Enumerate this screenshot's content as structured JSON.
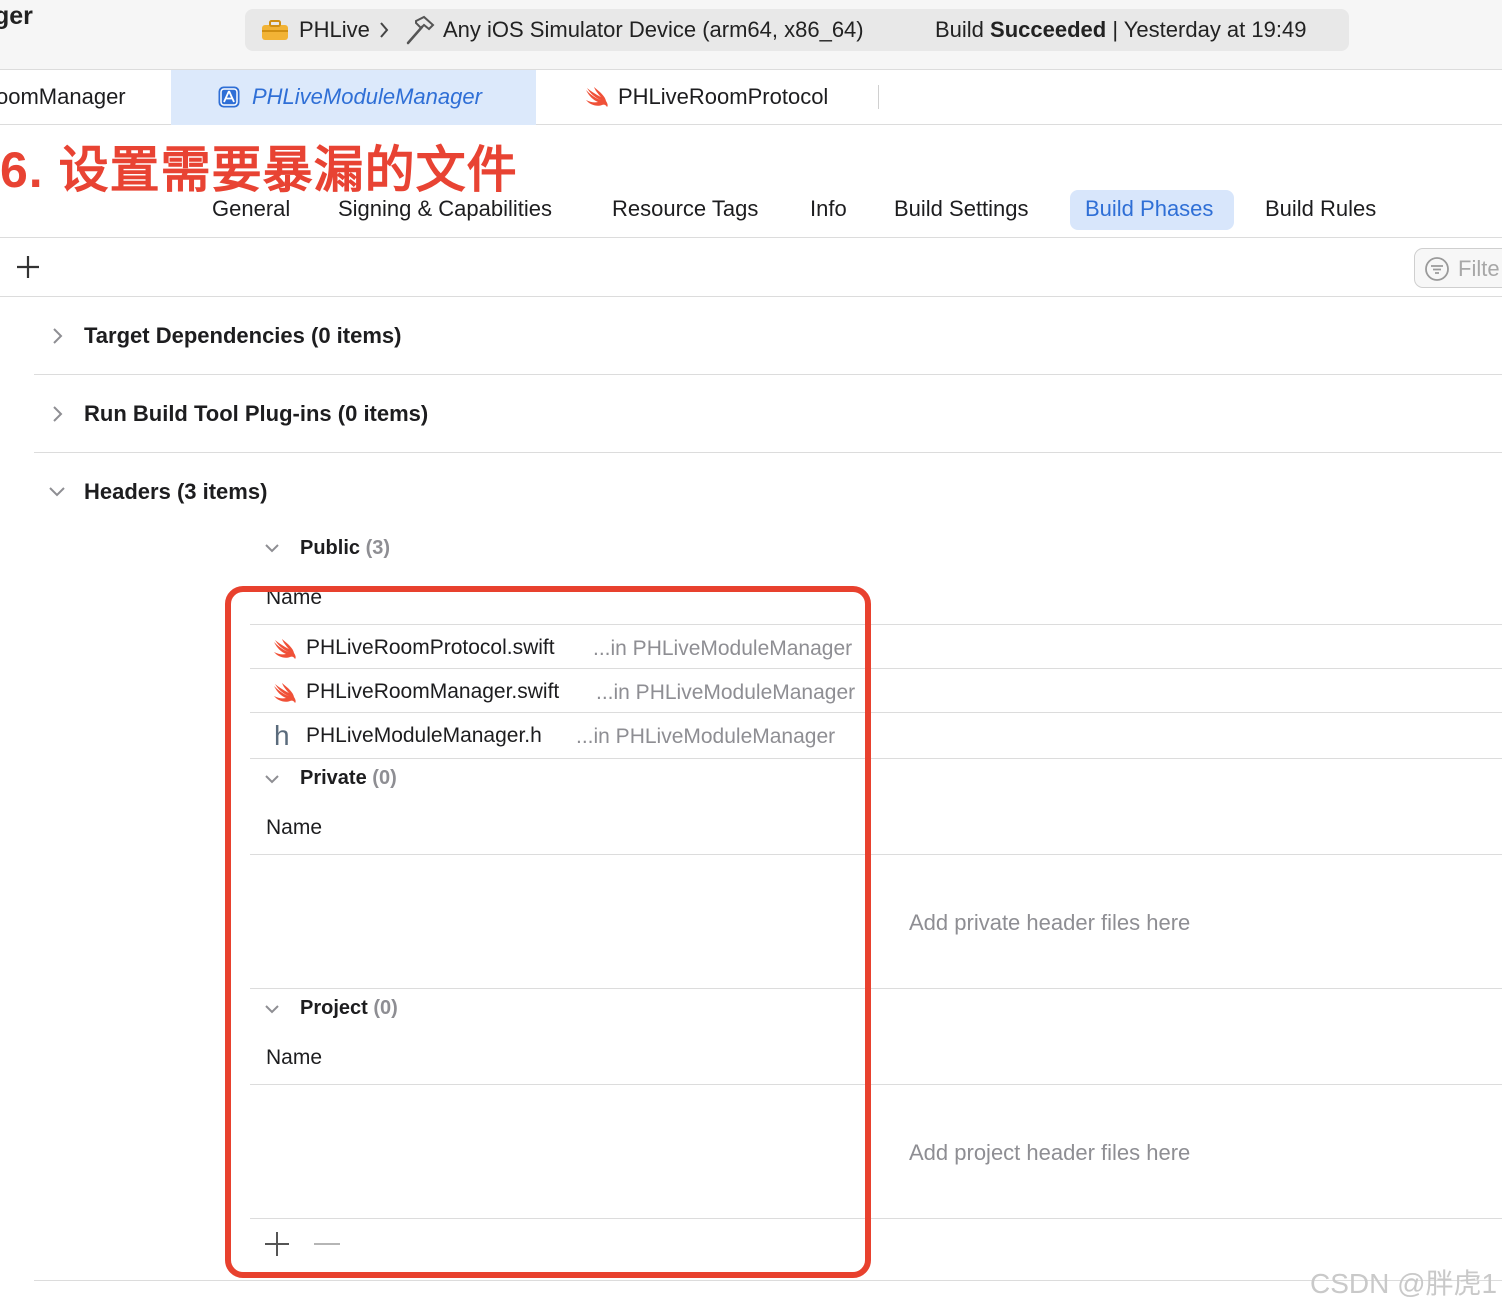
{
  "window": {
    "title_fragment": "ger"
  },
  "activity": {
    "scheme": "PHLive",
    "destination": "Any iOS Simulator Device (arm64, x86_64)",
    "status_prefix": "Build",
    "status_word": "Succeeded",
    "status_separator": "|",
    "timestamp": "Yesterday at 19:49"
  },
  "file_tabs": [
    {
      "label": "oomManager",
      "active": false
    },
    {
      "label": "PHLiveModuleManager",
      "active": true,
      "icon": "app-target-icon"
    },
    {
      "label": "PHLiveRoomProtocol",
      "active": false,
      "icon": "swift-icon"
    }
  ],
  "annotation": "6. 设置需要暴漏的文件",
  "editor_tabs": [
    {
      "label": "General"
    },
    {
      "label": "Signing & Capabilities"
    },
    {
      "label": "Resource Tags"
    },
    {
      "label": "Info"
    },
    {
      "label": "Build Settings"
    },
    {
      "label": "Build Phases",
      "active": true
    },
    {
      "label": "Build Rules"
    }
  ],
  "filter": {
    "placeholder": "Filte"
  },
  "phases": [
    {
      "title": "Target Dependencies (0 items)",
      "expanded": false
    },
    {
      "title": "Run Build Tool Plug-ins (0 items)",
      "expanded": false
    },
    {
      "title": "Headers (3 items)",
      "expanded": true
    }
  ],
  "headers": {
    "public": {
      "title": "Public",
      "count": "(3)",
      "column": "Name",
      "files": [
        {
          "name": "PHLiveRoomProtocol.swift",
          "location": "...in PHLiveModuleManager",
          "icon": "swift-icon"
        },
        {
          "name": "PHLiveRoomManager.swift",
          "location": "...in PHLiveModuleManager",
          "icon": "swift-icon"
        },
        {
          "name": "PHLiveModuleManager.h",
          "location": "...in PHLiveModuleManager",
          "icon": "header-h-icon"
        }
      ]
    },
    "private": {
      "title": "Private",
      "count": "(0)",
      "column": "Name",
      "placeholder": "Add private header files here"
    },
    "project": {
      "title": "Project",
      "count": "(0)",
      "column": "Name",
      "placeholder": "Add project header files here"
    }
  },
  "watermark": "CSDN @胖虎1",
  "colors": {
    "accent": "#2f6fd6",
    "active_tab_bg": "#dce9fb",
    "annotation_red": "#e84333",
    "swift_orange": "#f05138"
  }
}
